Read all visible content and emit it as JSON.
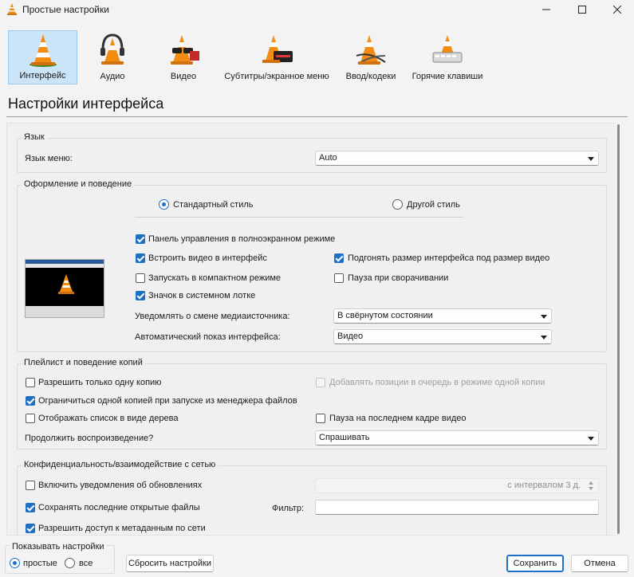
{
  "window": {
    "title": "Простые настройки"
  },
  "toolbar": {
    "items": [
      {
        "label": "Интерфейс",
        "icon": "interface-cone-icon",
        "active": true
      },
      {
        "label": "Аудио",
        "icon": "audio-cone-headphones-icon",
        "active": false
      },
      {
        "label": "Видео",
        "icon": "video-cone-glasses-icon",
        "active": false
      },
      {
        "label": "Субтитры/экранное меню",
        "icon": "subtitles-cone-icon",
        "active": false
      },
      {
        "label": "Ввод/кодеки",
        "icon": "input-codecs-cone-icon",
        "active": false
      },
      {
        "label": "Горячие клавиши",
        "icon": "hotkeys-cone-icon",
        "active": false
      }
    ]
  },
  "page": {
    "title": "Настройки интерфейса"
  },
  "language": {
    "group_title": "Язык",
    "menu_language_label": "Язык меню:",
    "menu_language_value": "Auto"
  },
  "appearance": {
    "group_title": "Оформление и поведение",
    "native_style_label": "Стандартный стиль",
    "native_style_selected": true,
    "custom_style_label": "Другой стиль",
    "custom_style_selected": false,
    "fullscreen_controller": {
      "label": "Панель управления в полноэкранном режиме",
      "checked": true
    },
    "embed_video": {
      "label": "Встроить видео в интерфейс",
      "checked": true
    },
    "resize_interface": {
      "label": "Подгонять размер интерфейса под размер видео",
      "checked": true
    },
    "compact_mode": {
      "label": "Запускать в компактном режиме",
      "checked": false
    },
    "pause_minimized": {
      "label": "Пауза при сворачивании",
      "checked": false
    },
    "systray_icon": {
      "label": "Значок в системном лотке",
      "checked": true
    },
    "notify_label": "Уведомлять о смене медиаисточника:",
    "notify_value": "В свёрнутом состоянии",
    "auto_raise_label": "Автоматический показ интерфейса:",
    "auto_raise_value": "Видео"
  },
  "playlist": {
    "group_title": "Плейлист и поведение копий",
    "one_instance": {
      "label": "Разрешить только одну копию",
      "checked": false
    },
    "enqueue_one_instance": {
      "label": "Добавлять позиции в очередь в режиме одной копии",
      "checked": false,
      "disabled": true
    },
    "one_instance_file_manager": {
      "label": "Ограничиться одной копией при запуске из менеджера файлов",
      "checked": true
    },
    "tree_view": {
      "label": "Отображать список в виде дерева",
      "checked": false
    },
    "pause_last_frame": {
      "label": "Пауза на последнем кадре видео",
      "checked": false
    },
    "resume_label": "Продолжить воспроизведение?",
    "resume_value": "Спрашивать"
  },
  "privacy": {
    "group_title": "Конфиденциальность/взаимодействие с сетью",
    "update_notify": {
      "label": "Включить уведомления об обновлениях",
      "checked": false
    },
    "update_interval_value": "с интервалом 3 д.",
    "save_recent": {
      "label": "Сохранять последние открытые файлы",
      "checked": true
    },
    "filter_label": "Фильтр:",
    "filter_value": "",
    "metadata_access": {
      "label": "Разрешить доступ к метаданным по сети",
      "checked": true
    }
  },
  "footer": {
    "show_settings_title": "Показывать настройки",
    "simple_label": "простые",
    "simple_selected": true,
    "all_label": "все",
    "all_selected": false,
    "reset_label": "Сбросить настройки",
    "save_label": "Сохранить",
    "cancel_label": "Отмена"
  },
  "colors": {
    "accent": "#1f6fc5",
    "toolbar_active_bg": "#cce4f7",
    "cone_orange": "#f28c13"
  }
}
